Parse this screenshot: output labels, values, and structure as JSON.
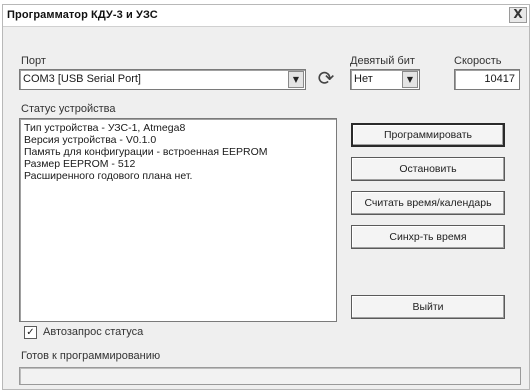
{
  "window": {
    "title": "Программатор КДУ-3 и УЗС",
    "close_glyph": "X"
  },
  "port": {
    "label": "Порт",
    "value": "COM3 [USB Serial Port]"
  },
  "ninth_bit": {
    "label": "Девятый бит",
    "value": "Нет"
  },
  "speed": {
    "label": "Скорость",
    "value": "10417"
  },
  "status": {
    "label": "Статус устройства",
    "lines": [
      "Тип устройства - УЗС-1, Atmega8",
      "Версия устройства - V0.1.0",
      "Память для конфигурации - встроенная EEPROM",
      "Размер EEPROM - 512",
      "Расширенного годового плана нет."
    ]
  },
  "buttons": {
    "program": "Программировать",
    "stop": "Остановить",
    "read_time": "Считать время/календарь",
    "sync_time": "Синхр-ть время",
    "exit": "Выйти"
  },
  "auto_request": {
    "label": "Автозапрос статуса",
    "checked": true
  },
  "ready_text": "Готов к программированию",
  "progress": {
    "value": 0
  },
  "icons": {
    "refresh": "refresh-icon",
    "dropdown": "chevron-down-icon",
    "check": "check-icon",
    "close": "close-icon"
  }
}
